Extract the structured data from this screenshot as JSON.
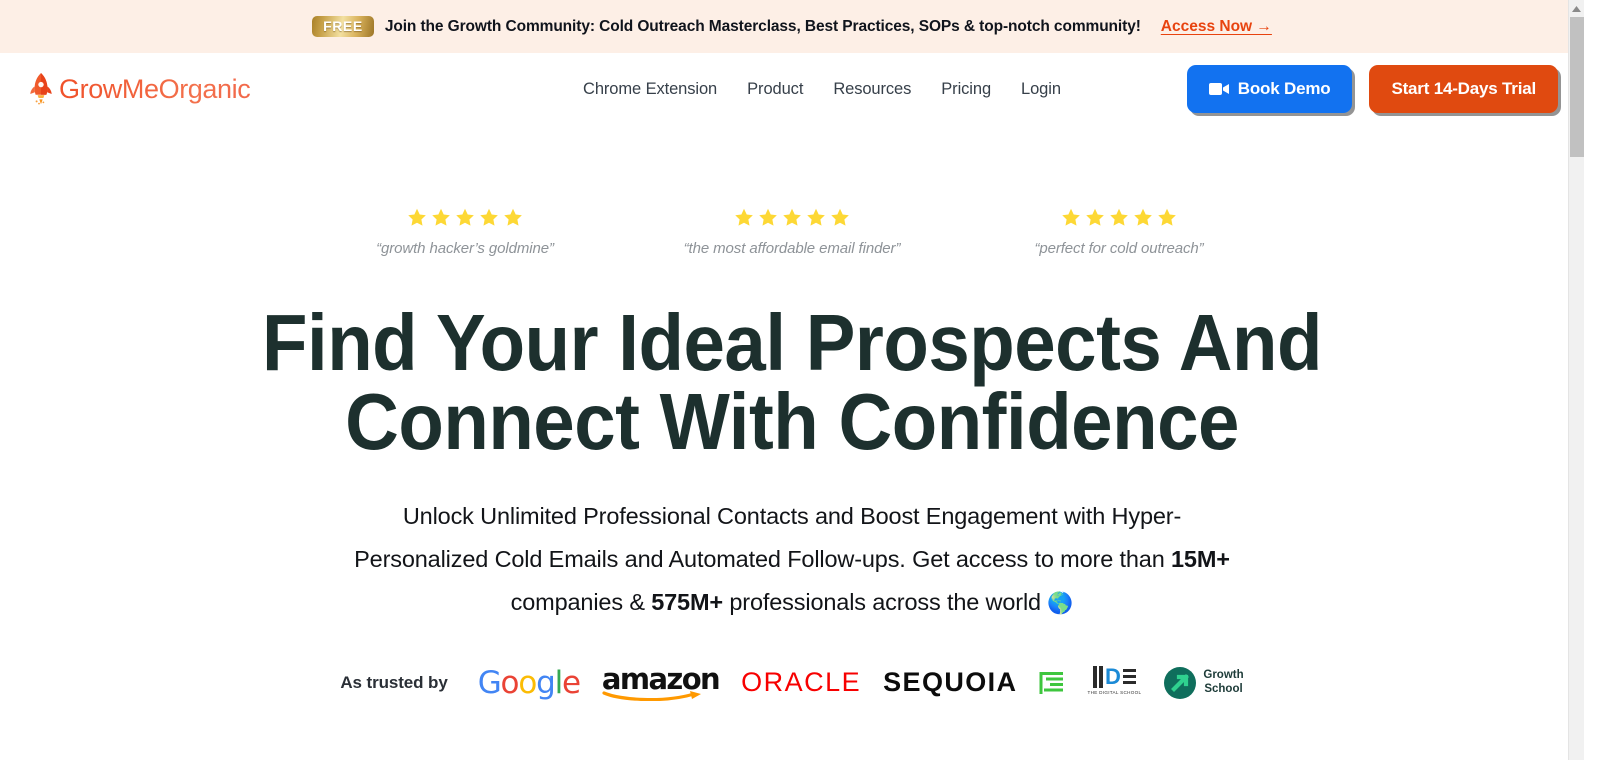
{
  "promo_banner": {
    "badge": "FREE",
    "message": "Join the Growth Community: Cold Outreach Masterclass, Best Practices, SOPs & top-notch community!",
    "link_label": "Access Now →",
    "background_color": "#fdefe6",
    "link_color": "#e8430f"
  },
  "header": {
    "brand_name": "GrowMeOrganic",
    "brand_icon": "rocket-icon",
    "nav": [
      {
        "label": "Chrome Extension"
      },
      {
        "label": "Product"
      },
      {
        "label": "Resources"
      },
      {
        "label": "Pricing"
      },
      {
        "label": "Login"
      }
    ],
    "book_demo": {
      "label": "Book Demo",
      "icon": "video-camera-icon",
      "color": "#1272f0"
    },
    "start_trial": {
      "label": "Start 14-Days Trial",
      "color": "#e04a10"
    }
  },
  "hero": {
    "reviews": [
      {
        "stars": 5,
        "quote": "“growth hacker’s goldmine”"
      },
      {
        "stars": 5,
        "quote": "“the most affordable email finder”"
      },
      {
        "stars": 5,
        "quote": "“perfect for cold outreach”"
      }
    ],
    "star_color": "#fdd835",
    "headline_line1": "Find Your Ideal Prospects And",
    "headline_line2": "Connect With Confidence",
    "headline_color": "#1d302e",
    "subhead_part1": "Unlock Unlimited Professional Contacts and Boost Engagement with Hyper-Personalized Cold Emails and Automated Follow-ups. Get access to more than ",
    "subhead_stat1": "15M+",
    "subhead_part2": " companies & ",
    "subhead_stat2": "575M+",
    "subhead_part3": " professionals across the world ",
    "subhead_emoji": "🌎"
  },
  "trusted_by": {
    "label": "As trusted by",
    "logos": [
      {
        "name": "google-logo",
        "text": "Google"
      },
      {
        "name": "amazon-logo",
        "text": "amazon"
      },
      {
        "name": "oracle-logo",
        "text": "ORACLE"
      },
      {
        "name": "sequoia-logo",
        "text": "SEQUOIA"
      },
      {
        "name": "lines-logo",
        "text": ""
      },
      {
        "name": "iide-logo",
        "text": "IIDE",
        "subtitle": "THE DIGITAL SCHOOL"
      },
      {
        "name": "growth-school-logo",
        "text_line1": "Growth",
        "text_line2": "School"
      }
    ]
  },
  "scrollbar": {
    "present": true,
    "position": "right"
  }
}
